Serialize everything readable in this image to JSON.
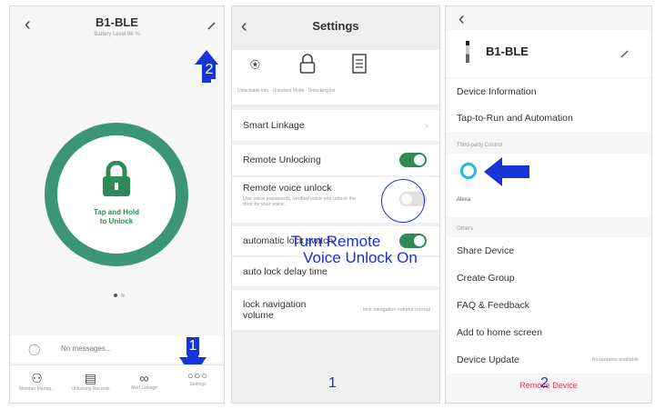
{
  "panel1": {
    "title": "B1-BLE",
    "subtitle": "Battery Level 96 %",
    "lock_button": {
      "line1": "Tap and Hold",
      "line2": "to Unlock"
    },
    "messages": "No messages...",
    "bottom_tabs": [
      "Member Manag...",
      "Unlocking Records",
      "Alert Linkage",
      "Settings"
    ],
    "step_label": "2",
    "step_label_bottom": "1"
  },
  "panel2": {
    "title": "Settings",
    "icons_caption": "Unlockable info  ·  Unlocked Mode  ·  Unlocking list",
    "rows": {
      "smart_linkage": "Smart Linkage",
      "remote_unlocking": "Remote Unlocking",
      "remote_voice": "Remote voice unlock",
      "remote_voice_desc": "Use voice passwords, verified voice you unlock the door by your voice...",
      "auto_switch": "automatic lock switch",
      "auto_delay": "auto lock delay time",
      "nav_volume_line1": "lock navigation",
      "nav_volume_line2": "volume",
      "nav_volume_value": "lock navigation volume normal"
    },
    "annotation_line1": "Turn Remote",
    "annotation_line2": "Voice Unlock On",
    "step": "1"
  },
  "panel3": {
    "title": "B1-BLE",
    "rows": {
      "device_info": "Device Information",
      "tap_to_run": "Tap-to-Run and Automation",
      "third_party": "Third-party Control",
      "alexa": "Alexa",
      "others": "Others",
      "share": "Share Device",
      "create_group": "Create Group",
      "faq": "FAQ & Feedback",
      "add_home": "Add to home screen",
      "device_update": "Device Update",
      "device_update_value": "No updates available",
      "remove": "Remove Device"
    },
    "step": "2"
  },
  "colors": {
    "accent_green": "#2e8b57",
    "annotation_blue": "#1c2fd6",
    "remove_red": "#e0345a"
  }
}
